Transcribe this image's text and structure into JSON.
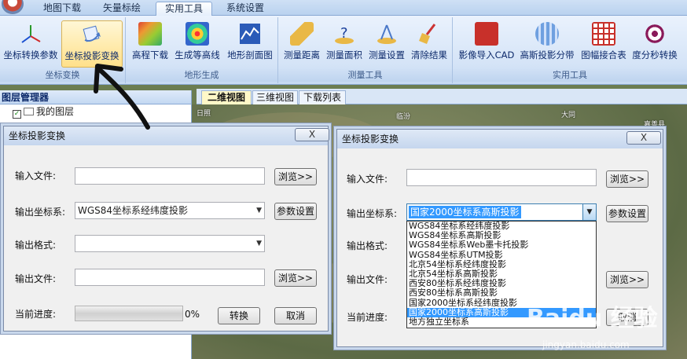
{
  "tabs": [
    {
      "label": "地图下载",
      "active": false
    },
    {
      "label": "矢量标绘",
      "active": false
    },
    {
      "label": "实用工具",
      "active": true
    },
    {
      "label": "系统设置",
      "active": false
    }
  ],
  "ribbon": {
    "groups": [
      {
        "label": "坐标变换",
        "buttons": [
          "坐标转换参数",
          "坐标投影变换"
        ]
      },
      {
        "label": "地形生成",
        "buttons": [
          "高程下载",
          "生成等高线",
          "地形剖面图"
        ]
      },
      {
        "label": "测量工具",
        "buttons": [
          "测量距离",
          "测量面积",
          "测量设置",
          "清除结果"
        ]
      },
      {
        "label": "实用工具",
        "buttons": [
          "影像导入CAD",
          "高斯投影分带",
          "图幅接合表",
          "度分秒转换"
        ]
      }
    ]
  },
  "layer_panel": {
    "title": "图层管理器",
    "items": [
      {
        "label": "我的图层",
        "checked": true
      }
    ]
  },
  "map_tabs": [
    {
      "label": "二维视图",
      "active": true
    },
    {
      "label": "三维视图",
      "active": false
    },
    {
      "label": "下载列表",
      "active": false
    }
  ],
  "map_labels": [
    "日照",
    "临汾",
    "大同",
    "嘉善县"
  ],
  "dialog_left": {
    "title": "坐标投影变换",
    "input_file_label": "输入文件:",
    "input_file_value": "",
    "browse_label": "浏览>>",
    "output_crs_label": "输出坐标系:",
    "output_crs_value": "WGS84坐标系经纬度投影",
    "params_label": "参数设置",
    "output_format_label": "输出格式:",
    "output_format_value": "",
    "output_file_label": "输出文件:",
    "output_file_value": "",
    "browse2_label": "浏览>>",
    "progress_label": "当前进度:",
    "progress_value": 0,
    "progress_text": "0%",
    "convert_label": "转换",
    "cancel_label": "取消",
    "close_label": "X"
  },
  "dialog_right": {
    "title": "坐标投影变换",
    "input_file_label": "输入文件:",
    "input_file_value": "",
    "browse_label": "浏览>>",
    "output_crs_label": "输出坐标系:",
    "output_crs_value": "国家2000坐标系高斯投影",
    "params_label": "参数设置",
    "output_format_label": "输出格式:",
    "output_file_label": "输出文件:",
    "browse2_label": "浏览>>",
    "progress_label": "当前进度:",
    "cancel_label": "取消",
    "close_label": "X",
    "dropdown_options": [
      "WGS84坐标系经纬度投影",
      "WGS84坐标系高斯投影",
      "WGS84坐标系Web墨卡托投影",
      "WGS84坐标系UTM投影",
      "北京54坐标系经纬度投影",
      "北京54坐标系高斯投影",
      "西安80坐标系经纬度投影",
      "西安80坐标系高斯投影",
      "国家2000坐标系经纬度投影",
      "国家2000坐标系高斯投影",
      "地方独立坐标系"
    ],
    "selected_index": 9
  },
  "watermark": {
    "text": "Baidu 经验",
    "sub": "jingyan.baidu.com"
  },
  "colors": {
    "ribbon_bg": "#d5e4f7",
    "accent": "#3399ff",
    "map": "#6f7a55"
  }
}
